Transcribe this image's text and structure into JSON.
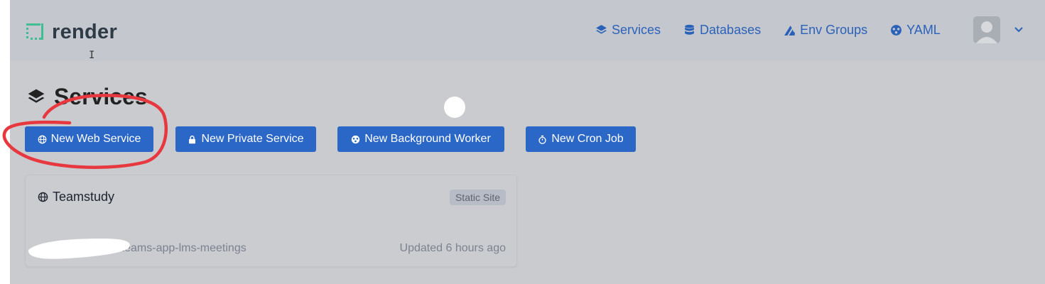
{
  "header": {
    "logo_text": "render",
    "nav": [
      {
        "label": "Services",
        "icon": "layers-icon"
      },
      {
        "label": "Databases",
        "icon": "database-icon"
      },
      {
        "label": "Env Groups",
        "icon": "env-groups-icon"
      },
      {
        "label": "YAML",
        "icon": "yaml-icon"
      }
    ]
  },
  "page": {
    "title": "Services",
    "buttons": {
      "web": "New Web Service",
      "private": "New Private Service",
      "worker": "New Background Worker",
      "cron": "New Cron Job"
    }
  },
  "services": [
    {
      "name": "Teamstudy",
      "badge": "Static Site",
      "repo": "g/msteams-app-lms-meetings",
      "updated": "Updated 6 hours ago"
    }
  ],
  "colors": {
    "accent": "#2b67c6",
    "annotation": "#e8383f"
  }
}
